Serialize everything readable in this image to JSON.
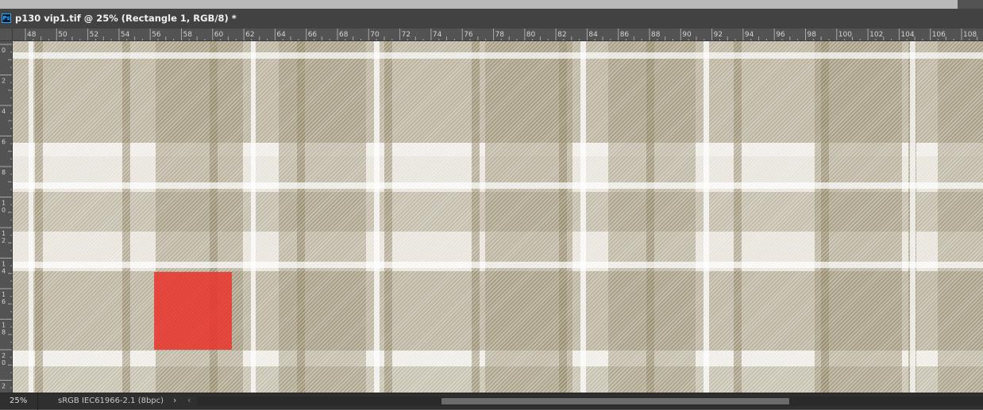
{
  "document": {
    "app_icon_text": "Ps",
    "title": "p130 vip1.tif @ 25% (Rectangle 1, RGB/8) *"
  },
  "rulers": {
    "horizontal_labels": [
      "48",
      "50",
      "52",
      "54",
      "56",
      "58",
      "60",
      "62",
      "64",
      "66",
      "68",
      "70",
      "72",
      "74",
      "76",
      "78",
      "80",
      "82",
      "84",
      "86",
      "88",
      "90",
      "92",
      "94",
      "96",
      "98",
      "100",
      "102",
      "104",
      "106",
      "108"
    ],
    "vertical_labels": [
      "0",
      "2",
      "4",
      "6",
      "8",
      "10",
      "12",
      "14",
      "16",
      "18",
      "20",
      "2"
    ]
  },
  "canvas": {
    "content": "plaid fabric texture",
    "selected_layer": "Rectangle 1",
    "rectangle_color": "#ee3028"
  },
  "status_bar": {
    "zoom": "25%",
    "profile": "sRGB IEC61966-2.1 (8bpc)",
    "arrow": "›",
    "scroll_left": "‹"
  },
  "colors": {
    "chrome_dark": "#424242",
    "ruler": "#535353",
    "statusbar": "#2f2f2f"
  }
}
